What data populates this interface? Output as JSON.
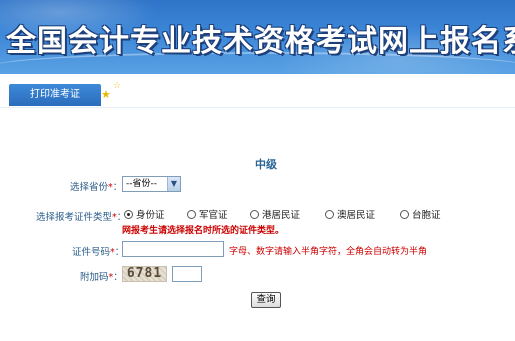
{
  "banner": {
    "title": "全国会计专业技术资格考试网上报名系统"
  },
  "tabs": [
    {
      "label": "打印准考证"
    }
  ],
  "decor": {
    "star_icon_1": "star-icon",
    "star_icon_2": "star-icon"
  },
  "form": {
    "level_title": "中级",
    "province": {
      "label": "选择省份",
      "required_mark": "*",
      "colon": "：",
      "value": "--省份--"
    },
    "cert_type": {
      "label": "选择报考证件类型",
      "required_mark": "*",
      "colon": "：",
      "options": [
        "身份证",
        "军官证",
        "港居民证",
        "澳居民证",
        "台胞证"
      ],
      "selected": "身份证",
      "warning": "网报考生请选择报名时所选的证件类型。"
    },
    "cert_number": {
      "label": "证件号码",
      "required_mark": "*",
      "colon": "：",
      "value": "",
      "hint": "字母、数字请输入半角字符，全角会自动转为半角"
    },
    "captcha": {
      "label": "附加码",
      "required_mark": "*",
      "colon": "：",
      "code": "6781",
      "value": ""
    },
    "submit_label": "查询"
  },
  "colors": {
    "banner_blue": "#3c87d8",
    "label_blue": "#2b5c8a",
    "warning_red": "#cc0000"
  }
}
